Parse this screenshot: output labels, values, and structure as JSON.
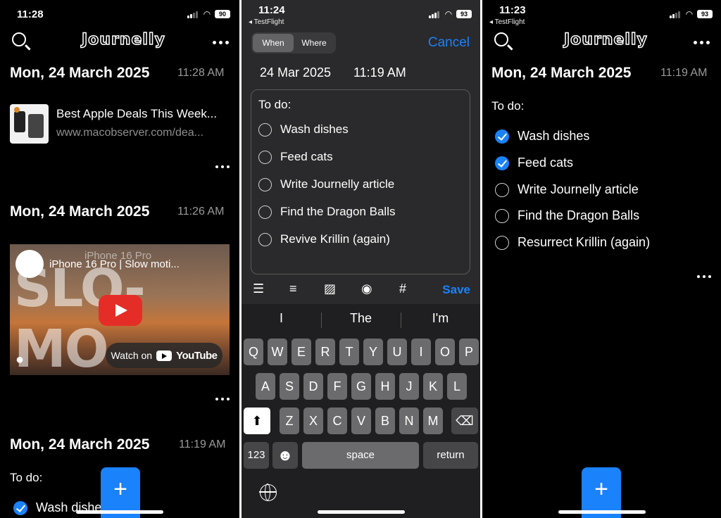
{
  "panel1": {
    "status": {
      "time": "11:28",
      "battery": "90"
    },
    "app_logo": "Journelly",
    "entries": [
      {
        "date": "Mon, 24 March 2025",
        "time": "11:28 AM",
        "link": {
          "title": "Best Apple Deals This Week...",
          "url": "www.macobserver.com/dea..."
        }
      },
      {
        "date": "Mon, 24 March 2025",
        "time": "11:26 AM",
        "video": {
          "title": "iPhone 16 Pro | Slow moti...",
          "watermark": "iPhone 16 Pro",
          "big_text": "SLO-MO",
          "watch_on": "Watch on",
          "platform": "YouTube"
        }
      },
      {
        "date": "Mon, 24 March 2025",
        "time": "11:19 AM",
        "todo_heading": "To do:",
        "first_item": "Wash dishes"
      }
    ],
    "fab": "+"
  },
  "panel2": {
    "status": {
      "time": "11:24",
      "back_app": "◂ TestFlight",
      "battery": "93"
    },
    "segments": [
      "When",
      "Where"
    ],
    "cancel": "Cancel",
    "date": "24 Mar 2025",
    "time": "11:19 AM",
    "todo_heading": "To do:",
    "items": [
      "Wash dishes",
      "Feed cats",
      "Write Journelly article",
      "Find the Dragon Balls",
      "Revive Krillin (again)"
    ],
    "toolbar": {
      "checklist": "☰",
      "list": "≡",
      "image": "▨",
      "camera": "◉",
      "tag": "#",
      "save": "Save"
    },
    "keyboard": {
      "suggestions": [
        "I",
        "The",
        "I'm"
      ],
      "row1": [
        "Q",
        "W",
        "E",
        "R",
        "T",
        "Y",
        "U",
        "I",
        "O",
        "P"
      ],
      "row2": [
        "A",
        "S",
        "D",
        "F",
        "G",
        "H",
        "J",
        "K",
        "L"
      ],
      "row3": [
        "Z",
        "X",
        "C",
        "V",
        "B",
        "N",
        "M"
      ],
      "numbers": "123",
      "emoji": "☻",
      "space": "space",
      "return": "return",
      "shift": "⬆",
      "delete": "⌫"
    }
  },
  "panel3": {
    "status": {
      "time": "11:23",
      "back_app": "◂ TestFlight",
      "battery": "93"
    },
    "app_logo": "Journelly",
    "date": "Mon, 24 March 2025",
    "time": "11:19 AM",
    "todo_heading": "To do:",
    "items": [
      {
        "label": "Wash dishes",
        "done": true
      },
      {
        "label": "Feed cats",
        "done": true
      },
      {
        "label": "Write Journelly article",
        "done": false
      },
      {
        "label": "Find the Dragon Balls",
        "done": false
      },
      {
        "label": "Resurrect Krillin (again)",
        "done": false
      }
    ],
    "fab": "+"
  },
  "colors": {
    "accent": "#1a82fb",
    "background": "#000000",
    "editor_bg": "#2a2a2c",
    "muted": "#9a9a9a"
  }
}
